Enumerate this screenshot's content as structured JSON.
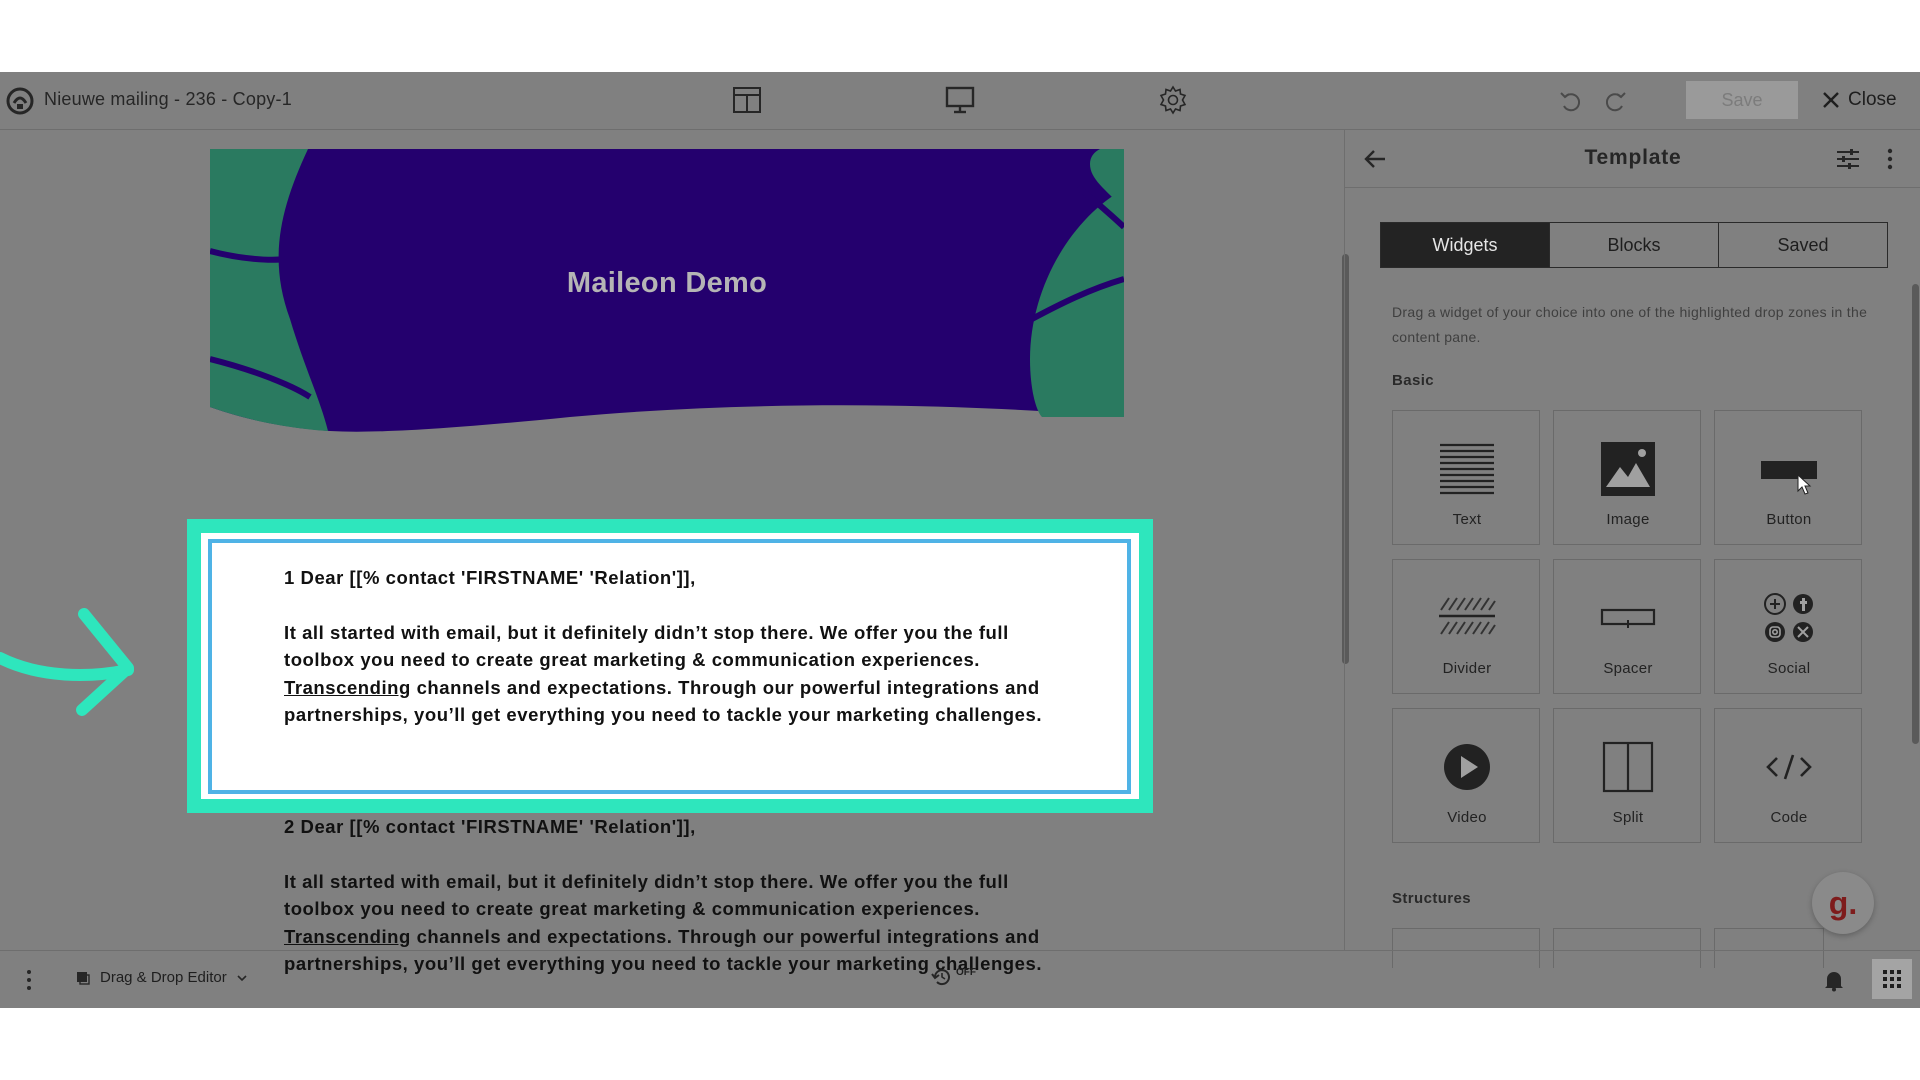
{
  "header": {
    "title": "Nieuwe mailing - 236 - Copy-1",
    "save_label": "Save",
    "close_label": "Close",
    "icons": [
      "app-logo",
      "layout-icon",
      "desktop-preview-icon",
      "settings-gear-icon",
      "undo-icon",
      "redo-icon",
      "close-icon"
    ]
  },
  "canvas": {
    "hero_title": "Maileon Demo",
    "colors": {
      "hero_bg": "#24006e",
      "hero_leaf": "#2a7a60",
      "highlight": "#2ee6bd",
      "selection": "#4fb3e6"
    },
    "blocks": [
      {
        "greeting": "1 Dear [[% contact 'FIRSTNAME' 'Relation']],",
        "body_before": "It all started with email, but it definitely didn’t stop there. We offer you the full toolbox you need to create great marketing & communication experiences. ",
        "link": "Transcending",
        "body_after": " channels and expectations. Through our powerful integrations and partnerships, you’ll get everything you need to tackle your marketing challenges."
      },
      {
        "greeting": "2 Dear [[% contact 'FIRSTNAME' 'Relation']],",
        "body_before": "It all started with email, but it definitely didn’t stop there. We offer you the full toolbox you need to create great marketing & communication experiences. ",
        "link": "Transcending",
        "body_after": " channels and expectations. Through our powerful integrations and partnerships, you’ll get everything you need to tackle your marketing challenges."
      }
    ]
  },
  "panel": {
    "title": "Template",
    "tabs": [
      {
        "label": "Widgets",
        "active": true
      },
      {
        "label": "Blocks",
        "active": false
      },
      {
        "label": "Saved",
        "active": false
      }
    ],
    "help_text": "Drag a widget of your choice into one of the highlighted drop zones in the content pane.",
    "basic_heading": "Basic",
    "widgets": [
      {
        "label": "Text",
        "icon": "text-icon"
      },
      {
        "label": "Image",
        "icon": "image-icon"
      },
      {
        "label": "Button",
        "icon": "button-icon"
      },
      {
        "label": "Divider",
        "icon": "divider-icon"
      },
      {
        "label": "Spacer",
        "icon": "spacer-icon"
      },
      {
        "label": "Social",
        "icon": "social-icon"
      },
      {
        "label": "Video",
        "icon": "video-icon"
      },
      {
        "label": "Split",
        "icon": "split-icon"
      },
      {
        "label": "Code",
        "icon": "code-icon"
      }
    ],
    "structures_heading": "Structures",
    "help_bubble": "g."
  },
  "footer": {
    "editor_mode": "Drag & Drop Editor",
    "autosave_state": "OFF",
    "icons": [
      "menu-dots-icon",
      "editor-icon",
      "chevron-down-icon",
      "autosave-icon",
      "bell-icon",
      "apps-grid-icon"
    ]
  }
}
